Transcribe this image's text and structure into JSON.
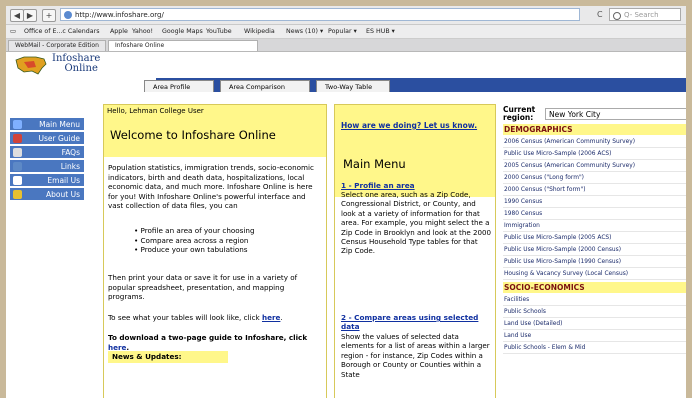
{
  "browser": {
    "back": "◀",
    "forward": "▶",
    "add": "+",
    "url": "http://www.infoshare.org/",
    "reload": "C",
    "search_placeholder": "Q- Search"
  },
  "bookmarks": [
    "Office of E...c Calendars",
    "Apple",
    "Yahoo!",
    "Google Maps",
    "YouTube",
    "Wikipedia",
    "News (10) ▾",
    "Popular ▾",
    "ES HUB ▾"
  ],
  "tabs": [
    "WebMail - Corporate Edition",
    "Infoshare Online"
  ],
  "site": {
    "logo": {
      "line1": "Infoshare",
      "line2": "Online"
    },
    "nav_tabs": [
      "Area Profile",
      "Area Comparison",
      "Two-Way Table"
    ],
    "left_menu": [
      {
        "label": "Main Menu",
        "icon": "house-icon",
        "color": "#7fb0ff"
      },
      {
        "label": "User Guide",
        "icon": "book-icon",
        "color": "#d0433a"
      },
      {
        "label": "FAQs",
        "icon": "question-icon",
        "color": "#dedede"
      },
      {
        "label": "Links",
        "icon": "link-icon",
        "color": "#5d89c6"
      },
      {
        "label": "Email Us",
        "icon": "envelope-icon",
        "color": "#ffffff"
      },
      {
        "label": "About Us",
        "icon": "globe-icon",
        "color": "#e7c030"
      }
    ],
    "col1": {
      "hello": "Hello, Lehman College User",
      "welcome": "Welcome to Infoshare Online",
      "intro": "Population statistics, immigration trends, socio-economic indicators, birth and death data, hospitalizations, local economic data, and much more. Infoshare Online is here for you! With Infoshare Online's powerful interface and vast collection of data files, you can",
      "bullets": [
        "Profile an area of your choosing",
        "Compare area across a region",
        "Produce your own tabulations"
      ],
      "print_text": "Then print your data or save it for use in a variety of popular spreadsheet, presentation, and mapping programs.",
      "tables_text": "To see what your tables will look like, click",
      "here": "here",
      "download_text": "To download a two-page guide to Infoshare, click",
      "news": "News & Updates:"
    },
    "col2": {
      "feedback": "How are we doing? Let us know.",
      "mainmenu": "Main Menu",
      "s1_title": "1 - Profile an area",
      "s1_text": "Select one area, such as a Zip Code, Congressional District, or County, and look at a variety of information for that area. For example, you might select the a Zip Code in Brooklyn and look at the 2000 Census Household Type tables for that Zip Code.",
      "s2_title": "2 - Compare areas using selected data",
      "s2_text": "Show the values of selected data elements for a list of areas within a larger region - for instance, Zip Codes within a Borough or County or Counties within a State"
    },
    "col3": {
      "region_label_1": "Current",
      "region_label_2": "region:",
      "region_value": "New York City",
      "demographics_head": "DEMOGRAPHICS",
      "demographics": [
        "2006 Census (American Community Survey)",
        "Public Use Micro-Sample (2006 ACS)",
        "2005 Census (American Community Survey)",
        "2000 Census (\"Long form\")",
        "2000 Census (\"Short form\")",
        "1990 Census",
        "1980 Census",
        "Immigration",
        "Public Use Micro-Sample (2005 ACS)",
        "Public Use Micro-Sample (2000 Census)",
        "Public Use Micro-Sample (1990 Census)",
        "Housing & Vacancy Survey (Local Census)"
      ],
      "socio_head": "SOCIO-ECONOMICS",
      "socio": [
        "Facilities",
        "Public Schools",
        "Land Use (Detailed)",
        "Land Use",
        "Public Schools - Elem & Mid"
      ]
    }
  }
}
